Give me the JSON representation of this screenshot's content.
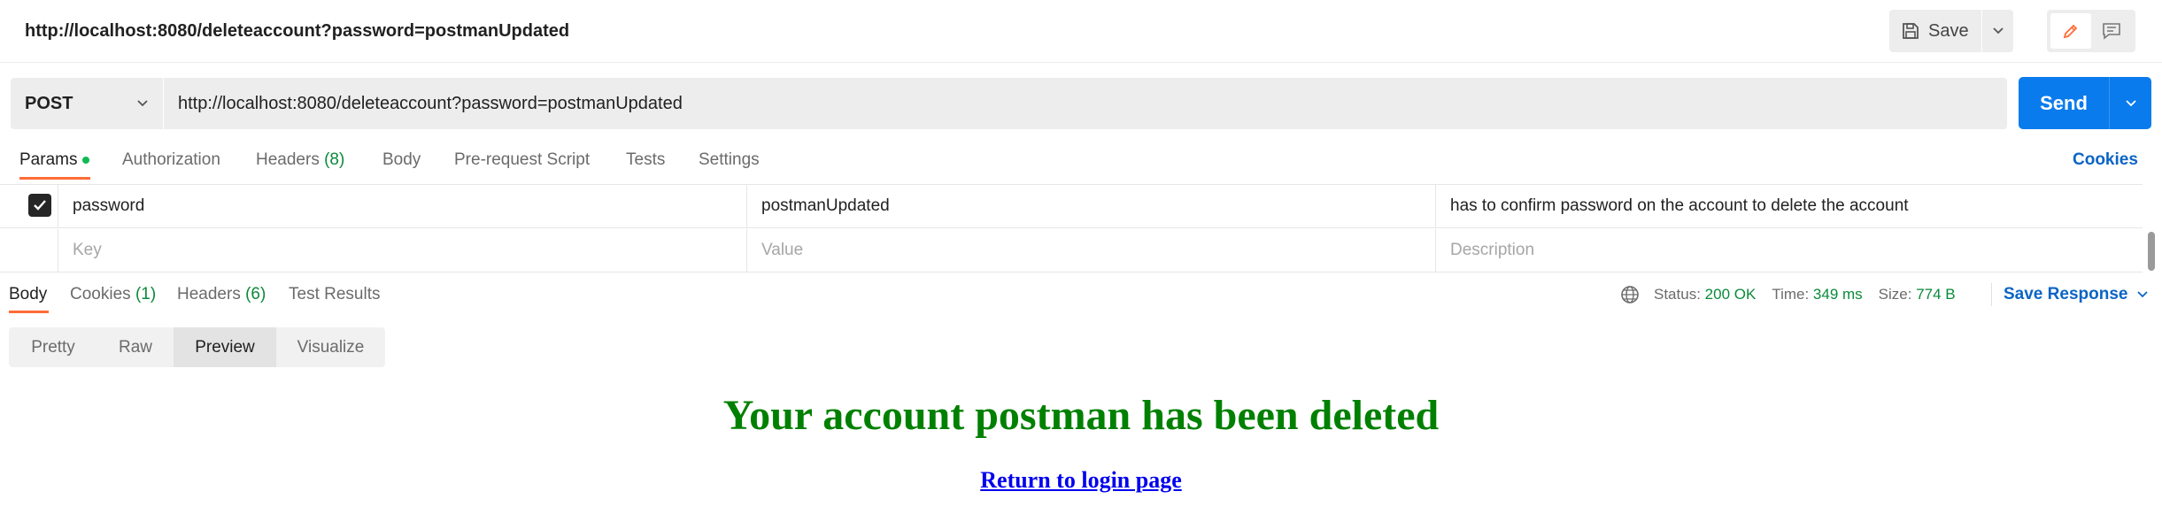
{
  "header": {
    "request_name": "http://localhost:8080/deleteaccount?password=postmanUpdated",
    "save_label": "Save"
  },
  "request": {
    "method": "POST",
    "url": "http://localhost:8080/deleteaccount?password=postmanUpdated",
    "send_label": "Send"
  },
  "request_tabs": {
    "params": "Params",
    "authorization": "Authorization",
    "headers": "Headers",
    "headers_count": "(8)",
    "body": "Body",
    "pre_request": "Pre-request Script",
    "tests": "Tests",
    "settings": "Settings",
    "cookies": "Cookies"
  },
  "params_table": {
    "row": {
      "checked": true,
      "key": "password",
      "value": "postmanUpdated",
      "description": "has to confirm password on the account to delete the account"
    },
    "placeholders": {
      "key": "Key",
      "value": "Value",
      "description": "Description"
    }
  },
  "response_tabs": {
    "body": "Body",
    "cookies": "Cookies",
    "cookies_count": "(1)",
    "headers": "Headers",
    "headers_count": "(6)",
    "test_results": "Test Results"
  },
  "response_meta": {
    "status_label": "Status:",
    "status_value": "200 OK",
    "time_label": "Time:",
    "time_value": "349 ms",
    "size_label": "Size:",
    "size_value": "774 B",
    "save_response": "Save Response"
  },
  "view_modes": [
    "Pretty",
    "Raw",
    "Preview",
    "Visualize"
  ],
  "active_view_mode": "Preview",
  "preview": {
    "heading": "Your account postman has been deleted",
    "link_text": "Return to login page"
  },
  "colors": {
    "accent_orange": "#ff6c37",
    "send_blue": "#097bed",
    "link_blue": "#0b64c4",
    "status_green": "#0a8a3a",
    "heading_green": "#008000"
  }
}
